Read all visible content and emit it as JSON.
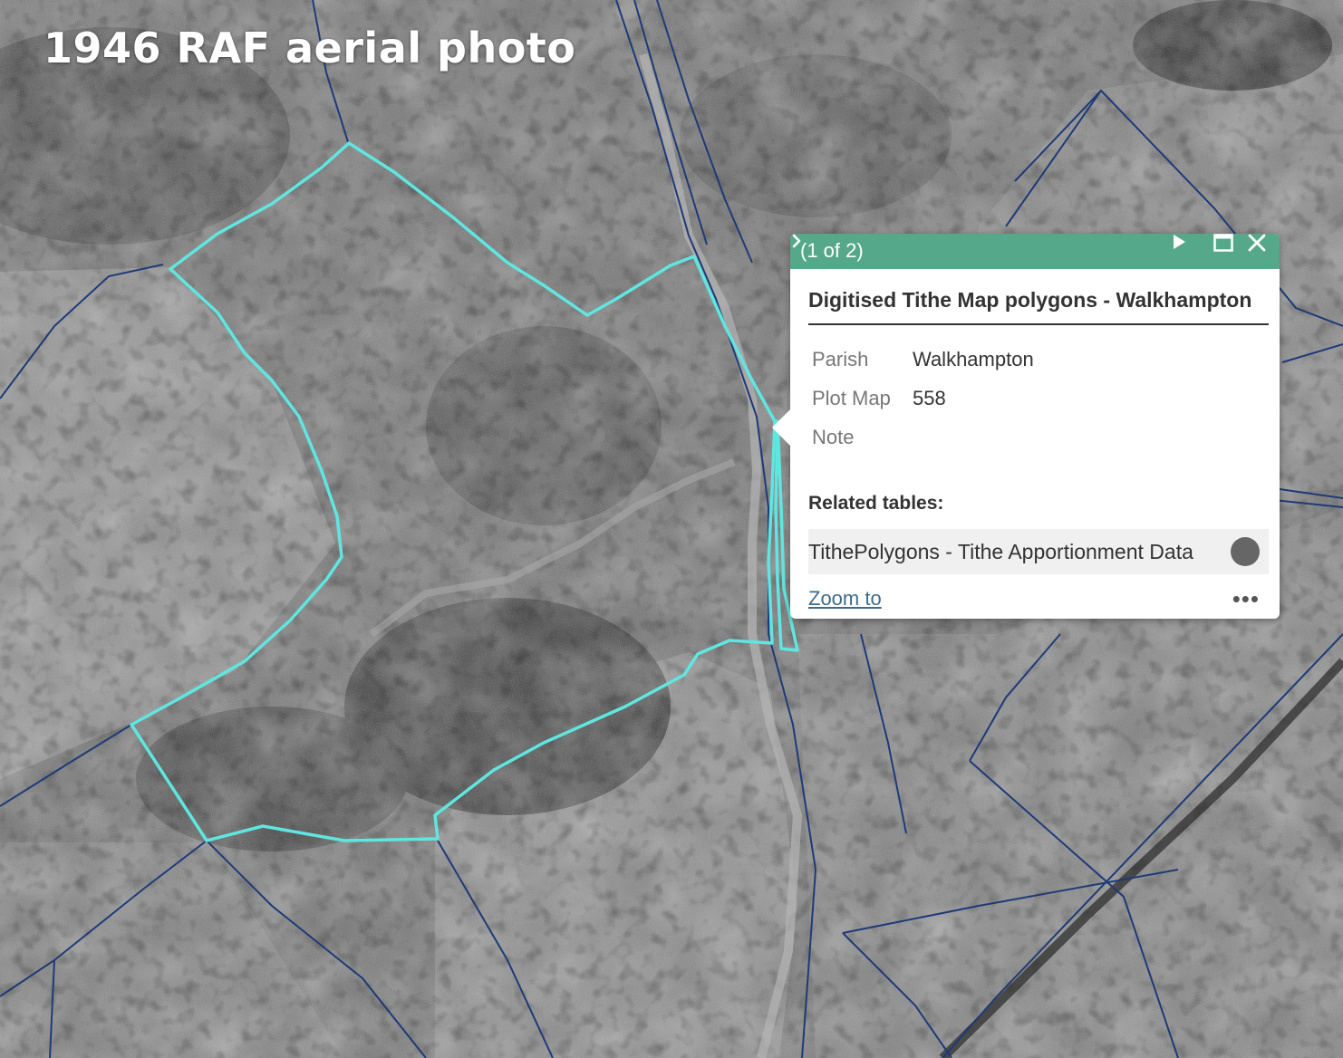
{
  "map": {
    "title": "1946 RAF aerial photo",
    "basemap": "black-and-white aerial photograph",
    "colors": {
      "selected_outline": "#5fe6e0",
      "parcel_lines": "#1e3a78",
      "popup_header": "#56a88a"
    }
  },
  "popup": {
    "count": "(1 of 2)",
    "icons": {
      "next": "play-next-icon",
      "maximize": "maximize-icon",
      "close": "close-icon"
    },
    "layer_title": "Digitised Tithe Map polygons - Walkhampton",
    "attributes": [
      {
        "key": "Parish",
        "value": "Walkhampton"
      },
      {
        "key": "Plot Map",
        "value": "558"
      },
      {
        "key": "Note",
        "value": ""
      }
    ],
    "related_heading": "Related tables:",
    "related_item": "TithePolygons - Tithe Apportionment Data",
    "zoom_label": "Zoom to",
    "more_label": "•••"
  }
}
